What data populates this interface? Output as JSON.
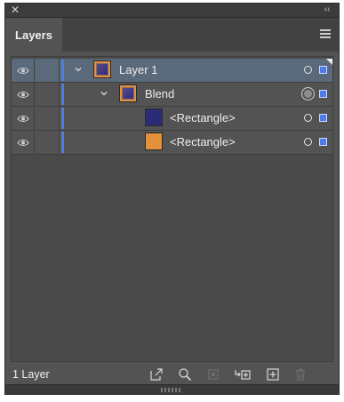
{
  "panel": {
    "title_tab": "Layers",
    "footer_count": "1 Layer"
  },
  "rows": [
    {
      "label": "Layer 1",
      "kind": "layer",
      "selected": true,
      "thumb": "blend"
    },
    {
      "label": "Blend",
      "kind": "blend",
      "selected": false,
      "thumb": "blend"
    },
    {
      "label": "<Rectangle>",
      "kind": "rectangle",
      "selected": false,
      "thumb": "navy"
    },
    {
      "label": "<Rectangle>",
      "kind": "rectangle",
      "selected": false,
      "thumb": "orange"
    }
  ],
  "colors": {
    "panel_bg": "#535353",
    "selected_row": "#5b6a7b",
    "layer_color": "#4f7be6",
    "navy_rect": "#2b2c78",
    "orange_rect": "#e3913b"
  },
  "icons": {
    "close": "close-icon",
    "collapse": "double-chevron-icon",
    "panel_menu": "hamburger-icon",
    "visibility": "eye-icon",
    "footer": [
      "export-icon",
      "search-icon",
      "clipping-mask-icon",
      "new-sublayer-icon",
      "new-layer-icon",
      "trash-icon"
    ]
  }
}
